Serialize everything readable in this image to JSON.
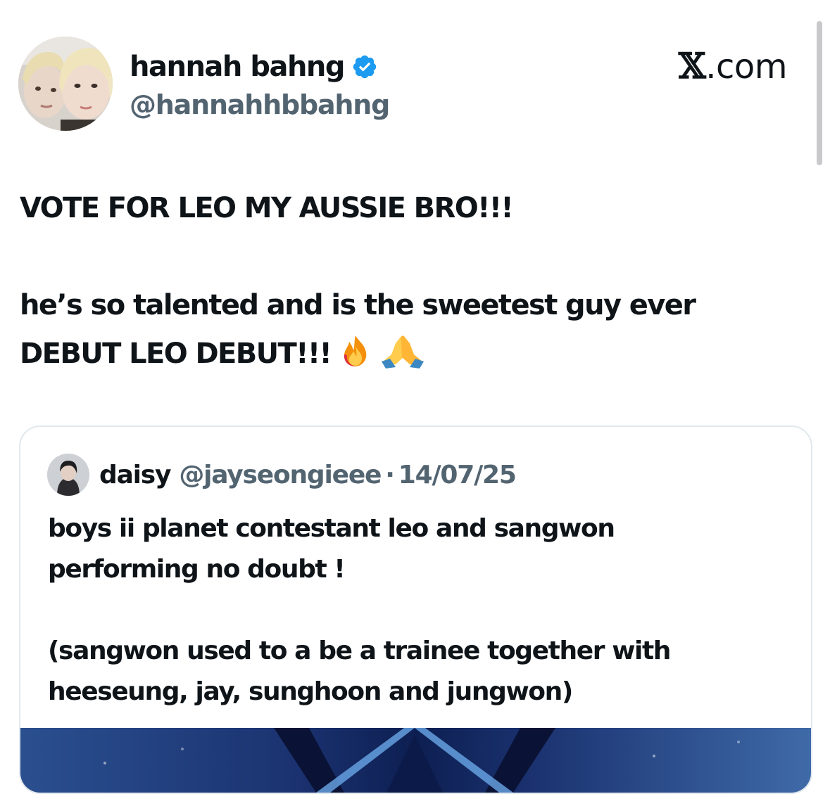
{
  "post": {
    "author": {
      "display_name": "hannah bahng",
      "handle": "@hannahhbbahng",
      "verified": true,
      "verified_color": "#1d9bf0"
    },
    "site_logo": {
      "mark": "𝕏",
      "suffix": ".com"
    },
    "text_lines": [
      "VOTE FOR LEO MY AUSSIE BRO!!!",
      "",
      "he’s so talented and is the sweetest guy ever",
      "DEBUT LEO DEBUT!!!"
    ],
    "emojis": [
      "fire-emoji",
      "folded-hands-emoji"
    ]
  },
  "quoted_post": {
    "display_name": "daisy",
    "handle": "@jayseongieee",
    "separator": "·",
    "date": "14/07/25",
    "text_lines": [
      "boys ii planet contestant leo and sangwon",
      "performing no doubt !",
      "",
      "(sangwon used to a be a trainee together with",
      "heeseung, jay, sunghoon and jungwon)"
    ]
  },
  "colors": {
    "text_primary": "#0f1419",
    "text_secondary": "#536471",
    "border": "#e1e8ed",
    "media_blue": "#1e3a7a"
  }
}
